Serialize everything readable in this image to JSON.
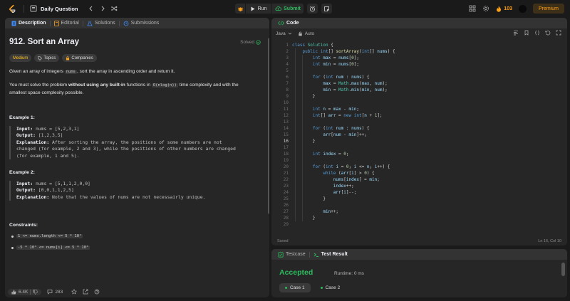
{
  "topbar": {
    "title": "Daily Question",
    "run_label": "Run",
    "submit_label": "Submit",
    "streak_count": "103",
    "premium_label": "Premium"
  },
  "left_tabs": [
    "Description",
    "Editorial",
    "Solutions",
    "Submissions"
  ],
  "problem": {
    "title": "912. Sort an Array",
    "solved_label": "Solved",
    "difficulty": "Medium",
    "topics_label": "Topics",
    "companies_label": "Companies",
    "desc1_pre": "Given an array of integers ",
    "desc1_code": "nums",
    "desc1_post": ", sort the array in ascending order and return it.",
    "desc2_pre": "You must solve the problem ",
    "desc2_bold": "without using any built-in",
    "desc2_mid": " functions in ",
    "desc2_code": "O(nlog(n))",
    "desc2_post": " time complexity and with the",
    "desc2_line2": "smallest space complexity possible.",
    "example1_title": "Example 1:",
    "example1_input_label": "Input:",
    "example1_input": " nums = [5,2,3,1]",
    "example1_output_label": "Output:",
    "example1_output": " [1,2,3,5]",
    "example1_expl_label": "Explanation:",
    "example1_expl_l1": " After sorting the array, the positions of some numbers are not",
    "example1_expl_l2": "changed (for example, 2 and 3), while the positions of other numbers are changed",
    "example1_expl_l3": "(for example, 1 and 5).",
    "example2_title": "Example 2:",
    "example2_input_label": "Input:",
    "example2_input": " nums = [5,1,1,2,0,0]",
    "example2_output_label": "Output:",
    "example2_output": " [0,0,1,1,2,5]",
    "example2_expl_label": "Explanation:",
    "example2_expl": " Note that the values of nums are not necessairly unique.",
    "constraints_title": "Constraints:",
    "constraint1": "1 <= nums.length <= 5 * 10⁴",
    "constraint2": "-5 * 10⁴ <= nums[i] <= 5 * 10⁴"
  },
  "left_footer": {
    "likes": "6.4K",
    "comments": "283"
  },
  "code_panel": {
    "tab_label": "Code",
    "language": "Java",
    "auto_label": "Auto",
    "status_left": "Saved",
    "status_right": "Ln 16, Col 10",
    "current_line": 16,
    "lines": [
      "class Solution {",
      "    public int[] sortArray(int[] nums) {",
      "        int max = nums[0];",
      "        int min = nums[0];",
      "",
      "        for (int num : nums) {",
      "            max = Math.max(max, num);",
      "            min = Math.min(min, num);",
      "        }",
      "",
      "        int n = max - min;",
      "        int[] arr = new int[n + 1];",
      "",
      "        for (int num : nums) {",
      "            arr[num - min]++;",
      "        }",
      "",
      "        int index = 0;",
      "",
      "        for (int i = 0; i <= n; i++) {",
      "            while (arr[i] > 0) {",
      "                nums[index] = min;",
      "                index++;",
      "                arr[i]--;",
      "            }",
      "",
      "            min++;",
      "        }",
      ""
    ]
  },
  "test_panel": {
    "testcase_label": "Testcase",
    "result_label": "Test Result",
    "status": "Accepted",
    "runtime": "Runtime: 0 ms",
    "cases": [
      "Case 1",
      "Case 2"
    ]
  },
  "colors": {
    "accent_orange": "#ffa116",
    "accent_green": "#2cbb5d",
    "medium_yellow": "#ffc01e",
    "tab_description_blue": "#3e8af7"
  }
}
